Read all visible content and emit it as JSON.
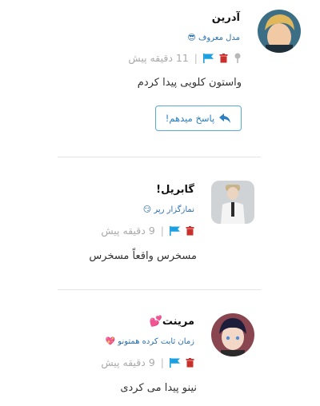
{
  "comments": [
    {
      "name": "آدرین",
      "badge": "مدل معروف",
      "badge_emoji": "😎",
      "time": "11 دقیقه پیش",
      "text": "واستون کلویی پیدا کردم",
      "reply_label": "پاسخ میدهم!",
      "icons": [
        "pin-icon",
        "trash-icon",
        "flag-icon"
      ]
    },
    {
      "name": "گابریل!",
      "badge": "نمازگزار رپر",
      "badge_emoji": "😏",
      "time": "9 دقیقه پیش",
      "text": "مسخرس واقعاً مسخرس",
      "icons": [
        "trash-icon",
        "flag-icon"
      ]
    },
    {
      "name": "مرینت",
      "name_emoji": "💕",
      "badge": "زمان ثابت کرده همتونو",
      "badge_emoji": "💖",
      "time": "9 دقیقه پیش",
      "text": "نینو پیدا می کردی",
      "icons": [
        "trash-icon",
        "flag-icon"
      ]
    }
  ],
  "colors": {
    "accent": "#2b7fbf",
    "trash": "#c9302c",
    "flag": "#1a9fe0",
    "meta": "#a9a9a9"
  }
}
